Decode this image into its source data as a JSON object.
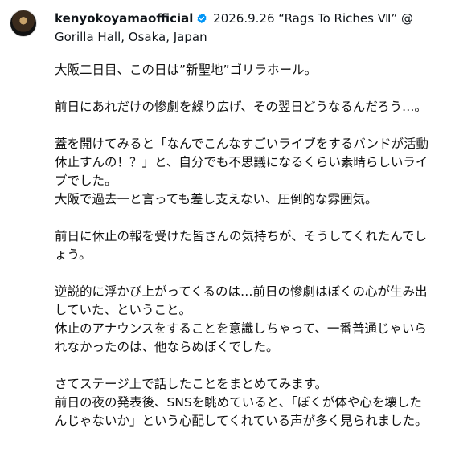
{
  "post": {
    "username": "kenyokoyamaofficial",
    "header_text": "2026.9.26 “Rags To Riches Ⅶ” @ Gorilla Hall, Osaka, Japan",
    "verified_color": "#0095f6"
  },
  "caption": {
    "paragraphs": [
      [
        "大阪二日目、この日は”新聖地”ゴリラホール。"
      ],
      [
        "前日にあれだけの惨劇を繰り広げ、その翌日どうなるんだろう…。"
      ],
      [
        "蓋を開けてみると「なんでこんなすごいライブをするバンドが活動休止すんの！？」と、自分でも不思議になるくらい素晴らしいライブでした。",
        "大阪で過去一と言っても差し支えない、圧倒的な雰囲気。"
      ],
      [
        "前日に休止の報を受けた皆さんの気持ちが、そうしてくれたんでしょう。"
      ],
      [
        "逆説的に浮かび上がってくるのは…前日の惨劇はぼくの心が生み出していた、ということ。",
        "休止のアナウンスをすることを意識しちゃって、一番普通じゃいられなかったのは、他ならぬぼくでした。"
      ],
      [
        "さてステージ上で話したことをまとめてみます。",
        "前日の夜の発表後、SNSを眺めていると、「ぼくが体や心を壊したんじゃないか」という心配してくれている声が多く見られました。"
      ]
    ]
  }
}
